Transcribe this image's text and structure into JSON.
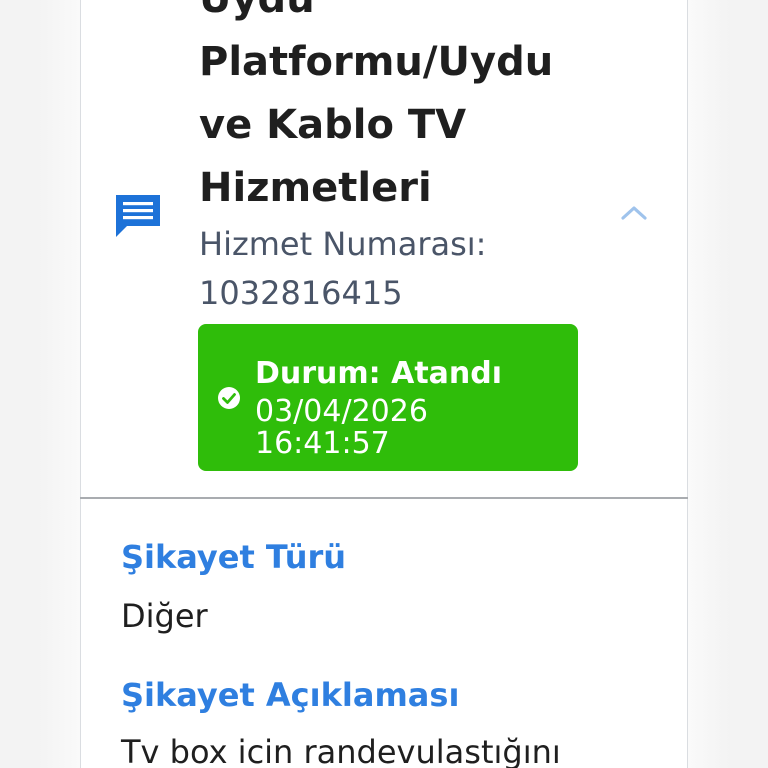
{
  "complaint": {
    "title": "Uydu\nPlatformu/Uydu\nve Kablo TV\nHizmetleri",
    "service_number_label": "Hizmet Numarası:",
    "service_number": "1032816415",
    "icons": {
      "message": "message-text-icon",
      "collapse": "chevron-up-icon",
      "status": "check-circle-icon"
    },
    "status": {
      "title": "Durum: Atandı",
      "date": "03/04/2026",
      "time": "16:41:57",
      "color": "#2fbd0a"
    }
  },
  "details": {
    "type_label": "Şikayet Türü",
    "type_value": "Diğer",
    "description_label": "Şikayet Açıklaması",
    "description_value": "Tv box icin randevulastığını"
  },
  "colors": {
    "accent": "#2f7fe0",
    "icon_blue": "#1d72d8",
    "chevron": "#9fc3ec",
    "status_green": "#2fbd0a"
  }
}
